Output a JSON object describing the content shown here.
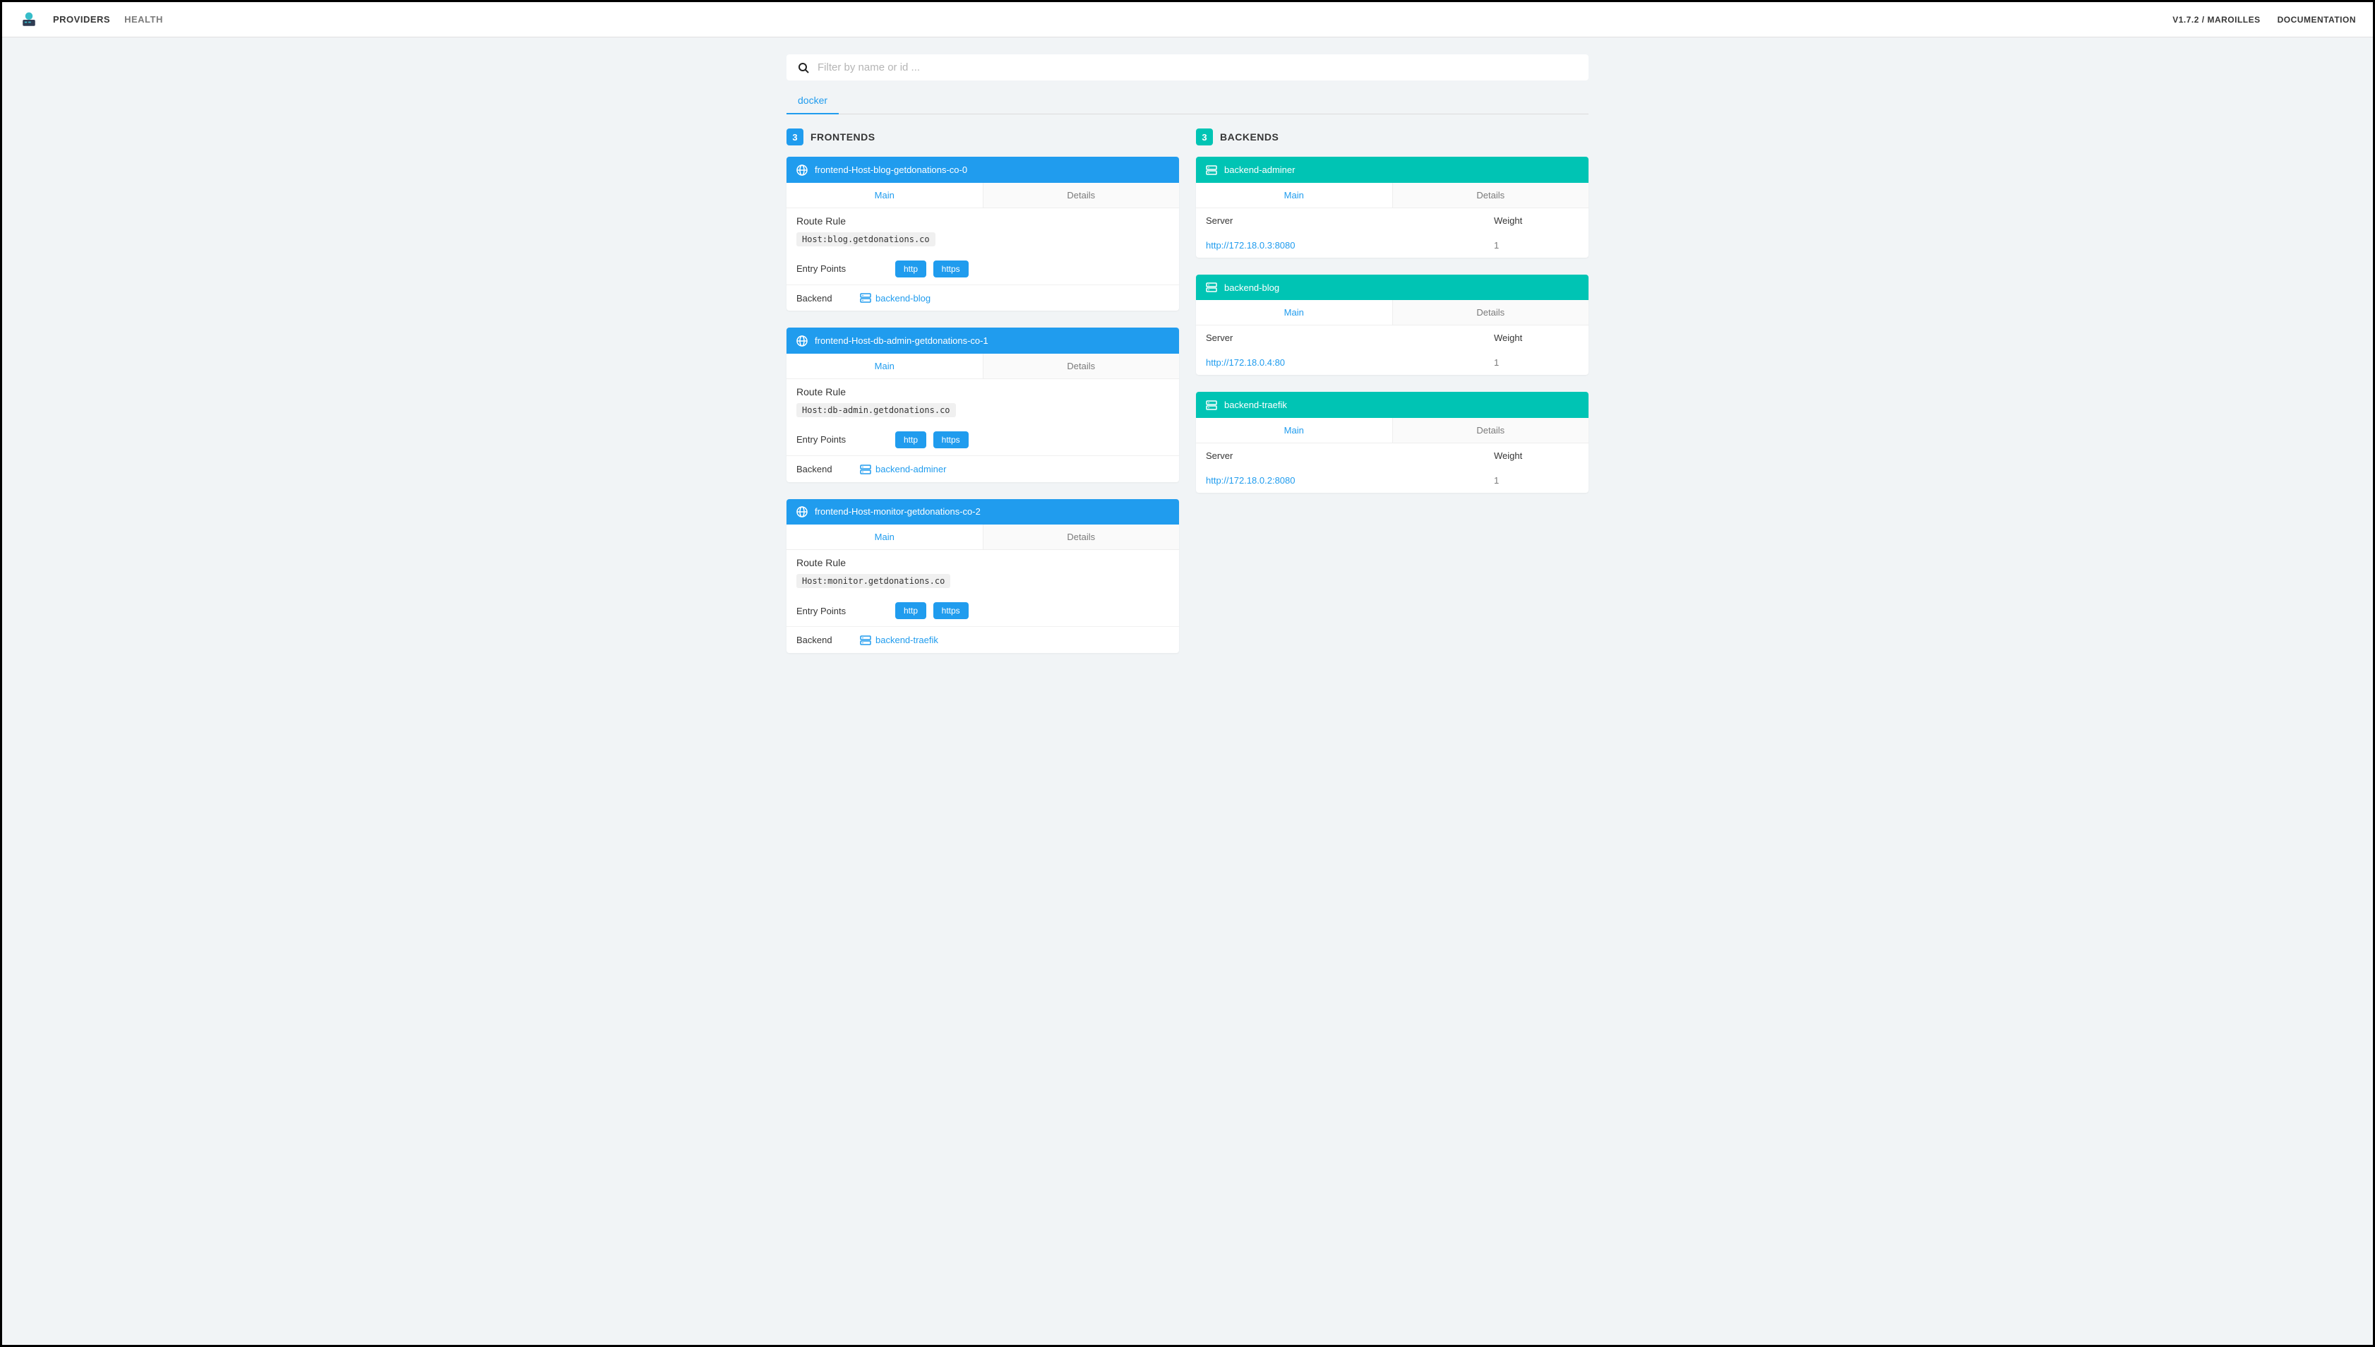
{
  "nav": {
    "providers": "PROVIDERS",
    "health": "HEALTH",
    "version": "V1.7.2 / MAROILLES",
    "docs": "DOCUMENTATION"
  },
  "search": {
    "placeholder": "Filter by name or id ..."
  },
  "provider_tab": "docker",
  "frontends": {
    "title": "FRONTENDS",
    "count": "3",
    "labels": {
      "route_rule": "Route Rule",
      "entry_points": "Entry Points",
      "backend": "Backend",
      "main": "Main",
      "details": "Details"
    },
    "items": [
      {
        "name": "frontend-Host-blog-getdonations-co-0",
        "rule": "Host:blog.getdonations.co",
        "eps": [
          "http",
          "https"
        ],
        "backend": "backend-blog"
      },
      {
        "name": "frontend-Host-db-admin-getdonations-co-1",
        "rule": "Host:db-admin.getdonations.co",
        "eps": [
          "http",
          "https"
        ],
        "backend": "backend-adminer"
      },
      {
        "name": "frontend-Host-monitor-getdonations-co-2",
        "rule": "Host:monitor.getdonations.co",
        "eps": [
          "http",
          "https"
        ],
        "backend": "backend-traefik"
      }
    ]
  },
  "backends": {
    "title": "BACKENDS",
    "count": "3",
    "labels": {
      "server": "Server",
      "weight": "Weight",
      "main": "Main",
      "details": "Details"
    },
    "items": [
      {
        "name": "backend-adminer",
        "url": "http://172.18.0.3:8080",
        "weight": "1"
      },
      {
        "name": "backend-blog",
        "url": "http://172.18.0.4:80",
        "weight": "1"
      },
      {
        "name": "backend-traefik",
        "url": "http://172.18.0.2:8080",
        "weight": "1"
      }
    ]
  }
}
